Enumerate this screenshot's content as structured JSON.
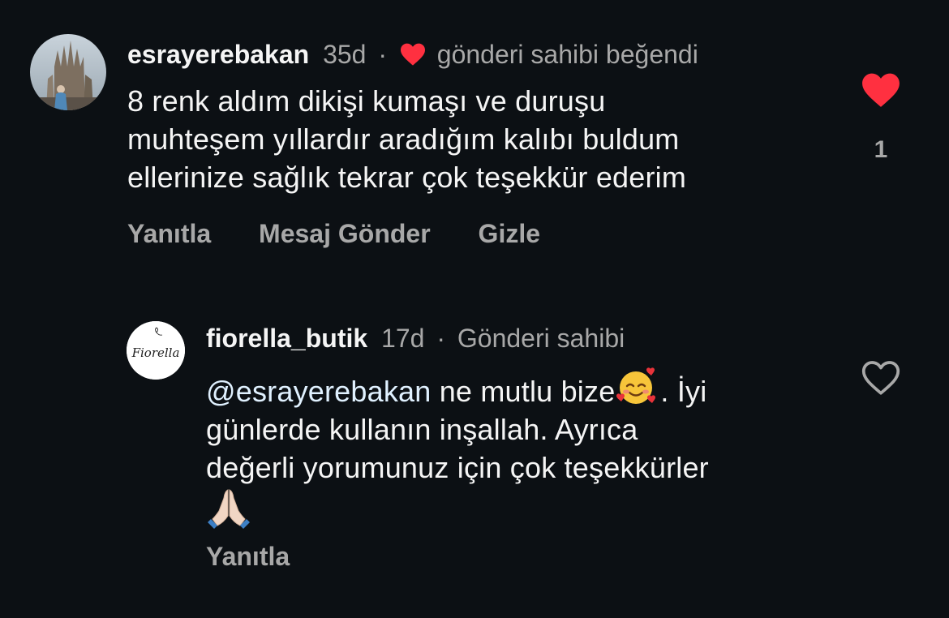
{
  "comments": [
    {
      "username": "esrayerebakan",
      "time": "35d",
      "separator": "·",
      "owner_liked_label": "gönderi sahibi beğendi",
      "body_lines": [
        "8 renk aldım dikişi kumaşı ve duruşu",
        "muhteşem yıllardır aradığım kalıbı buldum",
        "ellerinize sağlık tekrar çok teşekkür ederim"
      ],
      "actions": [
        "Yanıtla",
        "Mesaj Gönder",
        "Gizle"
      ],
      "like_count": "1",
      "liked": true
    },
    {
      "username": "fiorella_butik",
      "time": "17d",
      "separator": "·",
      "owner_label": "Gönderi sahibi",
      "avatar_text": "Fiorella",
      "mention": "@esrayerebakan",
      "body_part1": " ne mutlu bize",
      "body_part2": ". İyi",
      "body_line2": "günlerde kullanın inşallah. Ayrıca",
      "body_line3": "değerli yorumunuz için çok teşekkürler",
      "emoji_1": "smiling-face-with-hearts",
      "emoji_2": "folded-hands",
      "actions": [
        "Yanıtla"
      ],
      "liked": false
    }
  ],
  "colors": {
    "background": "#0c1014",
    "primary_text": "#f5f5f5",
    "secondary_text": "#a8a8a8",
    "like_red": "#ff3040",
    "mention": "#e0f1ff"
  }
}
